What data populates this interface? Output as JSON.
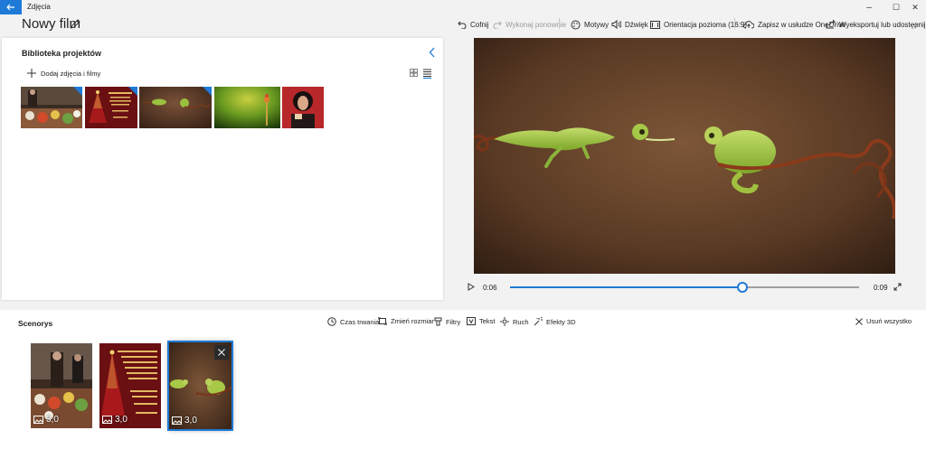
{
  "app": {
    "title": "Zdjęcia"
  },
  "window_controls": {
    "minimize": "–",
    "maximize": "☐",
    "close": "✕"
  },
  "project": {
    "title": "Nowy film"
  },
  "toolbar": {
    "undo": "Cofnij",
    "redo": "Wykonaj ponownie",
    "themes": "Motywy",
    "audio": "Dźwięk",
    "orientation": "Orientacja pozioma (16:9)",
    "save_onedrive": "Zapisz w usłudze OneDrive",
    "export": "Wyeksportuj lub udostępnij",
    "more": "···"
  },
  "library": {
    "title": "Biblioteka projektów",
    "add_media": "Dodaj zdjęcia i filmy",
    "items": [
      {
        "name": "party-table",
        "in_use": true
      },
      {
        "name": "christmas-card",
        "in_use": true
      },
      {
        "name": "chameleons",
        "in_use": true
      },
      {
        "name": "green-figure",
        "in_use": false
      },
      {
        "name": "woman-portrait",
        "in_use": false
      }
    ]
  },
  "player": {
    "current_time": "0:06",
    "end_time": "0:09",
    "progress": 0.667
  },
  "storyboard": {
    "title": "Scenorys",
    "tools": {
      "duration": "Czas trwania",
      "resize": "Zmień rozmiar",
      "filters": "Filtry",
      "text": "Tekst",
      "motion": "Ruch",
      "effects_3d": "Efekty 3D"
    },
    "remove_all": "Usuń wszystko",
    "cards": [
      {
        "duration": "3,0",
        "selected": false
      },
      {
        "duration": "3,0",
        "selected": false
      },
      {
        "duration": "3,0",
        "selected": true
      }
    ]
  },
  "colors": {
    "accent": "#1e7ad6",
    "background": "#f2f2f2",
    "panel": "#ffffff"
  }
}
